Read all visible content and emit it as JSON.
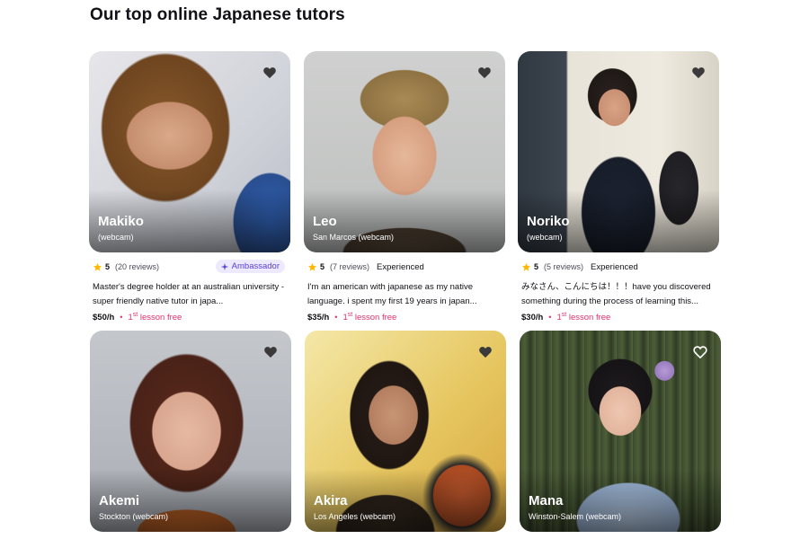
{
  "section_title": "Our top online Japanese tutors",
  "colors": {
    "accent": "#e0306d",
    "star": "#ffb800",
    "badge_bg": "#ede9fe",
    "badge_text": "#5b3fd6"
  },
  "tutors": [
    {
      "name": "Makiko",
      "location": "(webcam)",
      "rating": "5",
      "reviews": "(20 reviews)",
      "badge": "Ambassador",
      "description": "Master's degree holder at an australian university - super friendly native tutor in japa...",
      "price": "$50/h",
      "lesson_prefix": "1",
      "lesson_sup": "st",
      "lesson_suffix": " lesson free"
    },
    {
      "name": "Leo",
      "location": "San Marcos (webcam)",
      "rating": "5",
      "reviews": "(7 reviews)",
      "tag": "Experienced",
      "description": "I'm an american with japanese as my native language. i spent my first 19 years in japan...",
      "price": "$35/h",
      "lesson_prefix": "1",
      "lesson_sup": "st",
      "lesson_suffix": " lesson free"
    },
    {
      "name": "Noriko",
      "location": "(webcam)",
      "rating": "5",
      "reviews": "(5 reviews)",
      "tag": "Experienced",
      "description": "みなさん、こんにちは！！！have you discovered something during the process of learning this...",
      "price": "$30/h",
      "lesson_prefix": "1",
      "lesson_sup": "st",
      "lesson_suffix": " lesson free"
    },
    {
      "name": "Akemi",
      "location": "Stockton (webcam)"
    },
    {
      "name": "Akira",
      "location": "Los Angeles (webcam)"
    },
    {
      "name": "Mana",
      "location": "Winston-Salem (webcam)"
    }
  ]
}
